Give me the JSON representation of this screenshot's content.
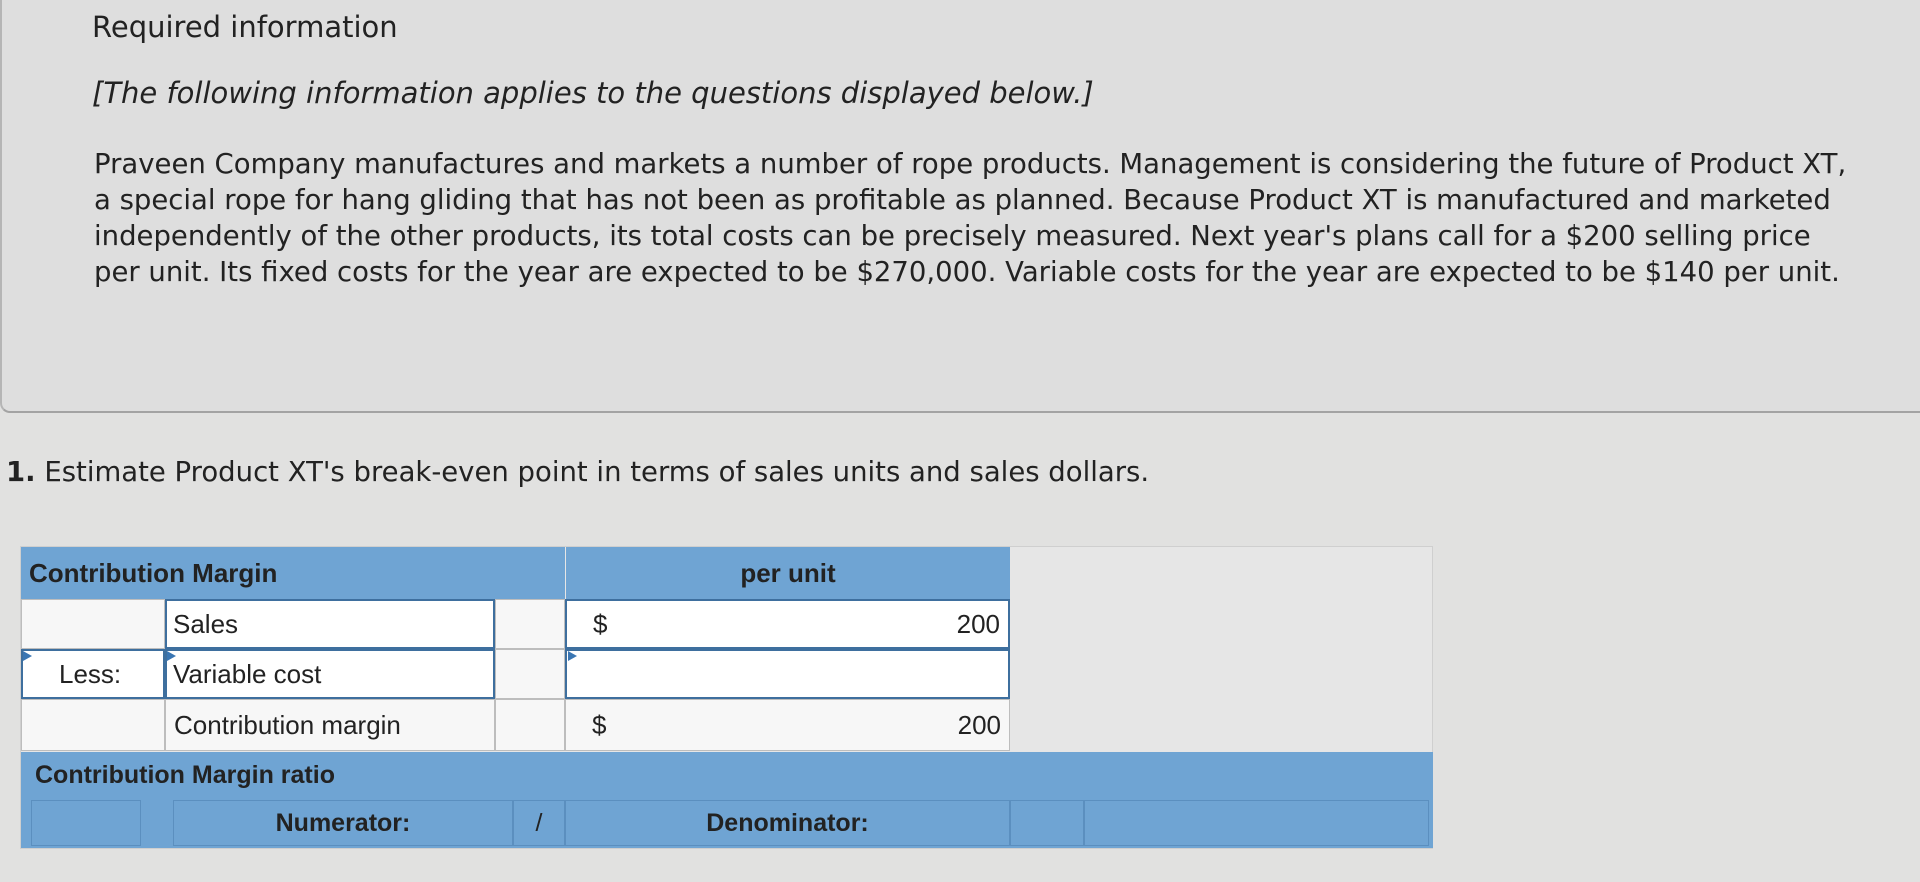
{
  "info": {
    "title": "Required information",
    "applies": "[The following information applies to the questions displayed below.]",
    "scenario": "Praveen Company manufactures and markets a number of rope products. Management is considering the future of Product XT, a special rope for hang gliding that has not been as profitable as planned. Because Product XT is manufactured and marketed independently of the other products, its total costs can be precisely measured. Next year's plans call for a $200 selling price per unit. Its fixed costs for the year are expected to be $270,000. Variable costs for the year are expected to be $140 per unit."
  },
  "question": {
    "number": "1.",
    "text": "Estimate Product XT's break-even point in terms of sales units and sales dollars."
  },
  "table": {
    "header_label": "Contribution Margin",
    "header_per_unit": "per unit",
    "rows": [
      {
        "prefix": "",
        "label": "Sales",
        "currency": "$",
        "value": "200"
      },
      {
        "prefix": "Less:",
        "label": "Variable cost",
        "currency": "",
        "value": ""
      },
      {
        "prefix": "",
        "label": "Contribution margin",
        "currency": "$",
        "value": "200"
      }
    ],
    "ratio_header": "Contribution Margin ratio",
    "numerator_label": "Numerator:",
    "divider": "/",
    "denominator_label": "Denominator:"
  }
}
